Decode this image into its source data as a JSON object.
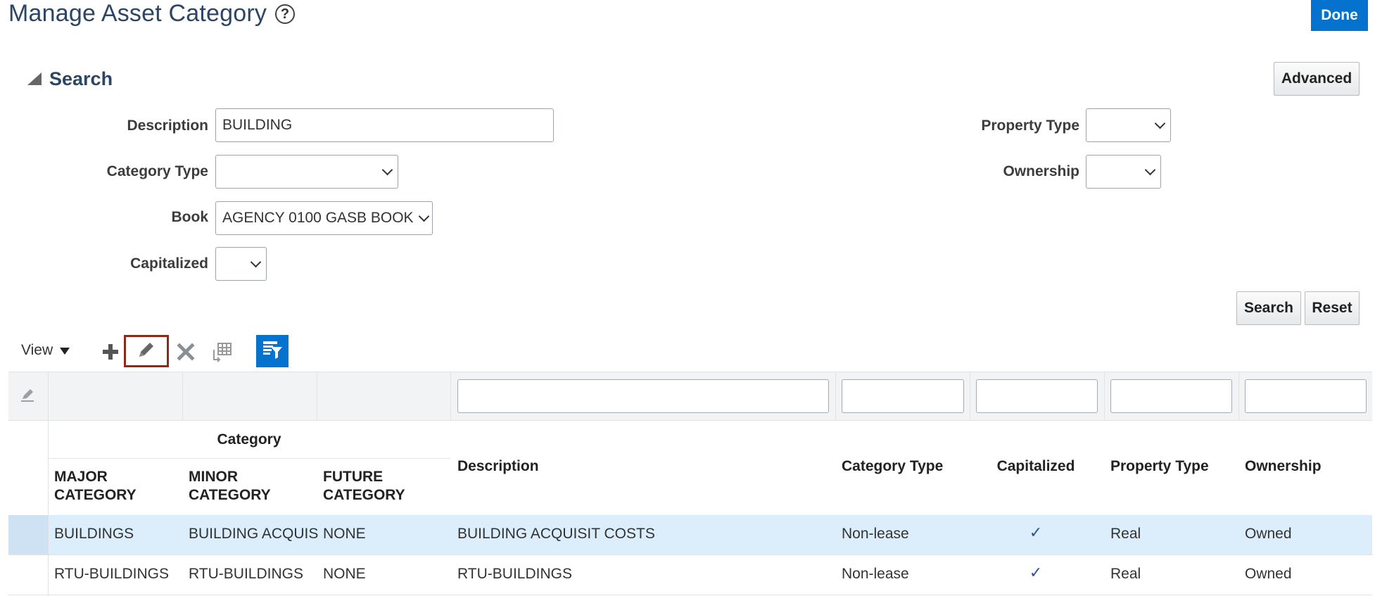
{
  "header": {
    "title": "Manage Asset Category",
    "done_label": "Done"
  },
  "search": {
    "title": "Search",
    "advanced_label": "Advanced",
    "search_label": "Search",
    "reset_label": "Reset",
    "fields": {
      "description": {
        "label": "Description",
        "value": "BUILDING"
      },
      "category_type": {
        "label": "Category Type",
        "value": ""
      },
      "book": {
        "label": "Book",
        "value": "AGENCY 0100 GASB BOOK"
      },
      "capitalized": {
        "label": "Capitalized",
        "value": ""
      },
      "property_type": {
        "label": "Property Type",
        "value": ""
      },
      "ownership": {
        "label": "Ownership",
        "value": ""
      }
    }
  },
  "toolbar": {
    "view_label": "View",
    "icons": [
      "add-icon",
      "edit-icon",
      "delete-icon",
      "freeze-icon",
      "query-by-example-icon"
    ]
  },
  "table": {
    "group_header": "Category",
    "columns": {
      "major": "MAJOR CATEGORY",
      "minor": "MINOR CATEGORY",
      "future": "FUTURE CATEGORY",
      "description": "Description",
      "category_type": "Category Type",
      "capitalized": "Capitalized",
      "property_type": "Property Type",
      "ownership": "Ownership"
    },
    "rows": [
      {
        "major": "BUILDINGS",
        "minor": "BUILDING ACQUIS",
        "future": "NONE",
        "description": "BUILDING ACQUISIT COSTS",
        "category_type": "Non-lease",
        "capitalized": "✓",
        "property_type": "Real",
        "ownership": "Owned",
        "selected": true
      },
      {
        "major": "RTU-BUILDINGS",
        "minor": "RTU-BUILDINGS",
        "future": "NONE",
        "description": "RTU-BUILDINGS",
        "category_type": "Non-lease",
        "capitalized": "✓",
        "property_type": "Real",
        "ownership": "Owned",
        "selected": false
      }
    ]
  },
  "colors": {
    "accent": "#0572ce",
    "title": "#2b4664",
    "selected_row": "#dcedfb",
    "edit_highlight": "#8b2a1b"
  }
}
